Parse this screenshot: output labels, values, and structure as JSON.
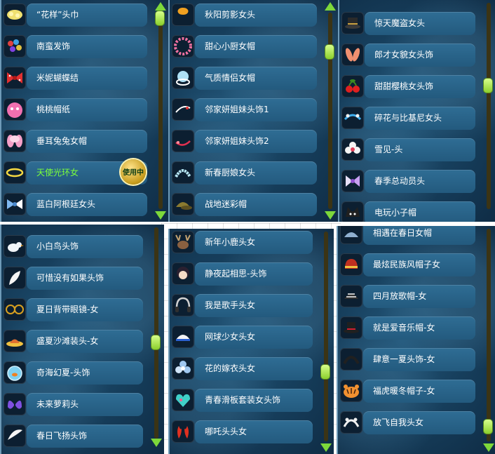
{
  "in_use_badge": "使用中",
  "panels": [
    {
      "items": [
        {
          "label": "“花样”头巾",
          "icon": "flower-headscarf-icon"
        },
        {
          "label": "南蛮发饰",
          "icon": "beaded-hair-ornament-icon"
        },
        {
          "label": "米妮蝴蝶结",
          "icon": "polka-dot-bow-icon"
        },
        {
          "label": "桃桃帽纸",
          "icon": "pink-face-hat-icon"
        },
        {
          "label": "垂耳兔兔女帽",
          "icon": "bunny-ear-hat-icon"
        },
        {
          "label": "天使光环女",
          "icon": "angel-halo-icon",
          "active": true
        },
        {
          "label": "蓝白阿根廷女头",
          "icon": "blue-white-bow-icon"
        }
      ]
    },
    {
      "items": [
        {
          "label": "秋阳剪影女头",
          "icon": "ginkgo-leaf-icon"
        },
        {
          "label": "甜心小厨女帽",
          "icon": "pink-chef-hat-icon"
        },
        {
          "label": "气质情侣女帽",
          "icon": "blue-ring-hat-icon"
        },
        {
          "label": "邻家妍姐妹头饰1",
          "icon": "white-hairpin-icon"
        },
        {
          "label": "邻家妍姐妹头饰2",
          "icon": "red-hairpin-icon"
        },
        {
          "label": "新春厨娘女头",
          "icon": "pearl-headband-icon"
        },
        {
          "label": "战地迷彩帽",
          "icon": "camo-cap-icon"
        }
      ]
    },
    {
      "items": [
        {
          "label": "惊天魔盗女头",
          "icon": "magician-hat-icon"
        },
        {
          "label": "郎才女貌女头饰",
          "icon": "pink-feather-icon"
        },
        {
          "label": "甜甜樱桃女头饰",
          "icon": "cherry-icon"
        },
        {
          "label": "碎花与比基尼女头",
          "icon": "floral-band-icon"
        },
        {
          "label": "雪见-头",
          "icon": "white-flower-icon"
        },
        {
          "label": "春季总动员头",
          "icon": "purple-bow-icon"
        },
        {
          "label": "电玩小子帽",
          "icon": "cat-cap-icon"
        }
      ]
    },
    {
      "items": [
        {
          "label": "小白鸟头饰",
          "icon": "white-bird-icon"
        },
        {
          "label": "可惜没有如果头饰",
          "icon": "white-feather-icon"
        },
        {
          "label": "夏日背带眼镜-女",
          "icon": "round-glasses-icon"
        },
        {
          "label": "盛夏沙滩装头-女",
          "icon": "beach-hat-icon"
        },
        {
          "label": "奇海幻夏-头饰",
          "icon": "fishbowl-icon"
        },
        {
          "label": "未来萝莉头",
          "icon": "purple-wings-icon"
        },
        {
          "label": "春日飞扬头饰",
          "icon": "white-wing-icon"
        }
      ]
    },
    {
      "items": [
        {
          "label": "新年小鹿头女",
          "icon": "deer-antler-icon"
        },
        {
          "label": "静夜起相思-头饰",
          "icon": "dark-hair-girl-icon"
        },
        {
          "label": "我是歌手头女",
          "icon": "headphones-icon"
        },
        {
          "label": "网球少女头女",
          "icon": "tennis-visor-icon"
        },
        {
          "label": "花的嫁衣头女",
          "icon": "blue-flower-icon"
        },
        {
          "label": "青春滑板套装女头饰",
          "icon": "heart-cap-icon"
        },
        {
          "label": "哪吒头头女",
          "icon": "red-flame-icon"
        }
      ]
    },
    {
      "items": [
        {
          "label": "相遇在春日女帽",
          "icon": "spring-hat-icon"
        },
        {
          "label": "最炫民族风帽子女",
          "icon": "ethnic-hat-icon"
        },
        {
          "label": "四月放歌帽-女",
          "icon": "striped-hat-icon"
        },
        {
          "label": "就是爱音乐帽-女",
          "icon": "black-top-hat-icon"
        },
        {
          "label": "肆意一夏头饰-女",
          "icon": "black-band-icon"
        },
        {
          "label": "福虎暖冬帽子-女",
          "icon": "tiger-hat-icon"
        },
        {
          "label": "放飞自我头女",
          "icon": "white-headband-icon"
        }
      ]
    }
  ],
  "colors": {
    "accent_green": "#7cff3b",
    "pill": "#2a6388",
    "panel_bg": "#17405e"
  }
}
